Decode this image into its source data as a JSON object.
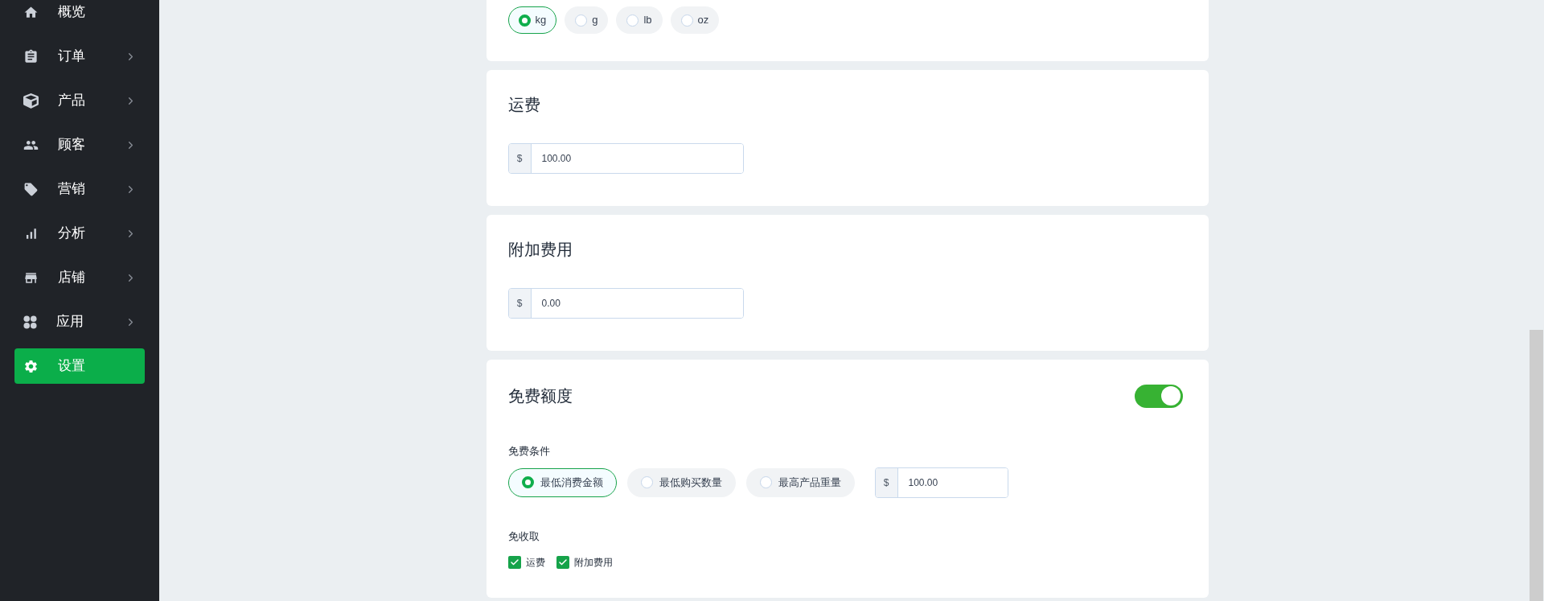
{
  "sidebar": {
    "items": [
      {
        "label": "概览",
        "expandable": false,
        "selected": false
      },
      {
        "label": "订单",
        "expandable": true,
        "selected": false
      },
      {
        "label": "产品",
        "expandable": true,
        "selected": false
      },
      {
        "label": "顾客",
        "expandable": true,
        "selected": false
      },
      {
        "label": "营销",
        "expandable": true,
        "selected": false
      },
      {
        "label": "分析",
        "expandable": true,
        "selected": false
      },
      {
        "label": "店铺",
        "expandable": true,
        "selected": false
      },
      {
        "label": "应用",
        "expandable": true,
        "selected": false
      },
      {
        "label": "设置",
        "expandable": false,
        "selected": true
      }
    ]
  },
  "weight_units": [
    {
      "label": "kg",
      "selected": true
    },
    {
      "label": "g",
      "selected": false
    },
    {
      "label": "lb",
      "selected": false
    },
    {
      "label": "oz",
      "selected": false
    }
  ],
  "shipping_fee": {
    "title": "运费",
    "prefix": "$",
    "value": "100.00"
  },
  "extra_fee": {
    "title": "附加费用",
    "prefix": "$",
    "value": "0.00"
  },
  "free_quota": {
    "title": "免费额度",
    "on": true,
    "condition_label": "免费条件",
    "conditions": [
      {
        "label": "最低消费金额",
        "selected": true
      },
      {
        "label": "最低购买数量",
        "selected": false
      },
      {
        "label": "最高产品重量",
        "selected": false
      }
    ],
    "threshold": {
      "prefix": "$",
      "value": "100.00"
    },
    "waive_label": "免收取",
    "waive": [
      {
        "label": "运费",
        "checked": true
      },
      {
        "label": "附加费用",
        "checked": true
      }
    ]
  }
}
